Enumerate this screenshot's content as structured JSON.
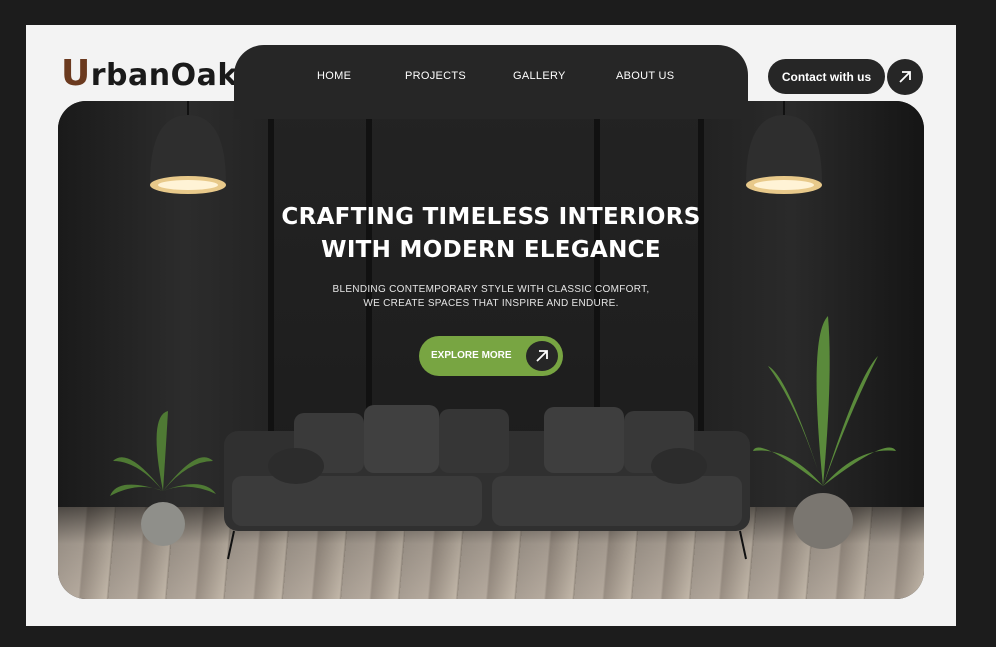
{
  "brand": {
    "logo_first": "U",
    "logo_rest": "rbanOak"
  },
  "nav": {
    "items": [
      "HOME",
      "PROJECTS",
      "GALLERY",
      "ABOUT US"
    ]
  },
  "header": {
    "contact_label": "Contact with us"
  },
  "hero": {
    "title_line1": "CRAFTING TIMELESS INTERIORS",
    "title_line2": "WITH MODERN ELEGANCE",
    "subtitle_line1": "BLENDING CONTEMPORARY STYLE WITH CLASSIC COMFORT,",
    "subtitle_line2": "WE CREATE SPACES THAT INSPIRE AND ENDURE.",
    "cta_label": "EXPLORE MORE"
  },
  "colors": {
    "accent": "#78a542",
    "dark": "#262626",
    "brand_brown": "#6b3a1f",
    "page_bg": "#f3f3f3"
  },
  "icons": {
    "cta_arrow": "arrow-up-right-icon",
    "header_arrow": "arrow-up-right-icon"
  }
}
